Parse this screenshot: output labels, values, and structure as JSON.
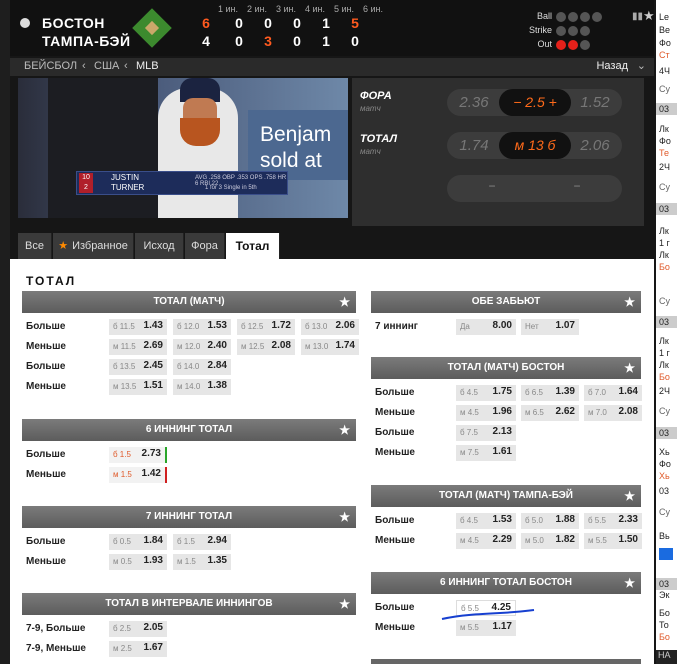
{
  "scoreboard": {
    "team_home": "БОСТОН",
    "team_away": "ТАМПА-БЭЙ",
    "innings": [
      "1 ин.",
      "2 ин.",
      "3 ин.",
      "4 ин.",
      "5 ин.",
      "6 ин."
    ],
    "home_scores": [
      "6",
      "0",
      "0",
      "0",
      "1",
      "5"
    ],
    "away_scores": [
      "4",
      "0",
      "3",
      "0",
      "1",
      "0"
    ],
    "ball_label": "Ball",
    "strike_label": "Strike",
    "out_label": "Out",
    "balls": 0,
    "strikes": 0,
    "outs": 2
  },
  "breadcrumb": {
    "items": [
      "БЕЙСБОЛ",
      "США",
      "MLB"
    ],
    "back_label": "Назад"
  },
  "video": {
    "sign_text": "Benjam sold at",
    "overlay_num1": "10",
    "overlay_num2": "2",
    "overlay_name1": "JUSTIN",
    "overlay_name2": "TURNER",
    "overlay_stats": "AVG .258  OBP .353  OPS .758  HR 6  RBI 22",
    "overlay_stats2": "1 for 3  Single in 5th"
  },
  "odds_panel": {
    "fora_label": "ФОРА",
    "fora_sub": "матч",
    "fora_left": "2.36",
    "fora_center": "− 2.5 +",
    "fora_right": "1.52",
    "total_label": "ТОТАЛ",
    "total_sub": "матч",
    "total_left": "1.74",
    "total_center": "м 13 б",
    "total_right": "2.06",
    "dash1": "−",
    "dash2": "−"
  },
  "tabs": [
    "Все",
    "Избранное",
    "Исход",
    "Фора",
    "Тотал"
  ],
  "content": {
    "title": "ТОТАЛ",
    "markets": {
      "total_match": {
        "title": "ТОТАЛ (МАТЧ)",
        "rows": [
          {
            "label": "Больше",
            "cells": [
              [
                "б 11.5",
                "1.43"
              ],
              [
                "б 12.0",
                "1.53"
              ],
              [
                "б 12.5",
                "1.72"
              ],
              [
                "б 13.0",
                "2.06"
              ]
            ]
          },
          {
            "label": "Меньше",
            "cells": [
              [
                "м 11.5",
                "2.69"
              ],
              [
                "м 12.0",
                "2.40"
              ],
              [
                "м 12.5",
                "2.08"
              ],
              [
                "м 13.0",
                "1.74"
              ]
            ]
          },
          {
            "label": "Больше",
            "cells": [
              [
                "б 13.5",
                "2.45"
              ],
              [
                "б 14.0",
                "2.84"
              ]
            ]
          },
          {
            "label": "Меньше",
            "cells": [
              [
                "м 13.5",
                "1.51"
              ],
              [
                "м 14.0",
                "1.38"
              ]
            ]
          }
        ]
      },
      "inning6_total": {
        "title": "6 ИННИНГ ТОТАЛ",
        "rows": [
          {
            "label": "Больше",
            "cells": [
              [
                "б 1.5",
                "2.73"
              ]
            ]
          },
          {
            "label": "Меньше",
            "cells": [
              [
                "м 1.5",
                "1.42"
              ]
            ]
          }
        ]
      },
      "inning7_total": {
        "title": "7 ИННИНГ ТОТАЛ",
        "rows": [
          {
            "label": "Больше",
            "cells": [
              [
                "б 0.5",
                "1.84"
              ],
              [
                "б 1.5",
                "2.94"
              ]
            ]
          },
          {
            "label": "Меньше",
            "cells": [
              [
                "м 0.5",
                "1.93"
              ],
              [
                "м 1.5",
                "1.35"
              ]
            ]
          }
        ]
      },
      "interval_total": {
        "title": "ТОТАЛ В ИНТЕРВАЛЕ ИННИНГОВ",
        "rows": [
          {
            "label": "7-9, Больше",
            "cells": [
              [
                "б 2.5",
                "2.05"
              ]
            ]
          },
          {
            "label": "7-9, Меньше",
            "cells": [
              [
                "м 2.5",
                "1.67"
              ]
            ]
          }
        ]
      },
      "both_score": {
        "title": "ОБЕ ЗАБЬЮТ",
        "rows": [
          {
            "label": "7 иннинг",
            "cells": [
              [
                "Да",
                "8.00"
              ],
              [
                "Нет",
                "1.07"
              ]
            ]
          }
        ]
      },
      "total_boston": {
        "title": "ТОТАЛ (МАТЧ) БОСТОН",
        "rows": [
          {
            "label": "Больше",
            "cells": [
              [
                "б 4.5",
                "1.75"
              ],
              [
                "б 6.5",
                "1.39"
              ],
              [
                "б 7.0",
                "1.64"
              ]
            ]
          },
          {
            "label": "Меньше",
            "cells": [
              [
                "м 4.5",
                "1.96"
              ],
              [
                "м 6.5",
                "2.62"
              ],
              [
                "м 7.0",
                "2.08"
              ]
            ]
          },
          {
            "label": "Больше",
            "cells": [
              [
                "б 7.5",
                "2.13"
              ]
            ]
          },
          {
            "label": "Меньше",
            "cells": [
              [
                "м 7.5",
                "1.61"
              ]
            ]
          }
        ]
      },
      "total_tampa": {
        "title": "ТОТАЛ (МАТЧ) ТАМПА-БЭЙ",
        "rows": [
          {
            "label": "Больше",
            "cells": [
              [
                "б 4.5",
                "1.53"
              ],
              [
                "б 5.0",
                "1.88"
              ],
              [
                "б 5.5",
                "2.33"
              ]
            ]
          },
          {
            "label": "Меньше",
            "cells": [
              [
                "м 4.5",
                "2.29"
              ],
              [
                "м 5.0",
                "1.82"
              ],
              [
                "м 5.5",
                "1.50"
              ]
            ]
          }
        ]
      },
      "inning6_boston": {
        "title": "6 ИННИНГ ТОТАЛ БОСТОН",
        "rows": [
          {
            "label": "Больше",
            "cells": [
              [
                "б 5.5",
                "4.25"
              ]
            ]
          },
          {
            "label": "Меньше",
            "cells": [
              [
                "м 5.5",
                "1.17"
              ]
            ]
          }
        ]
      }
    }
  },
  "right_strip": {
    "lines": [
      "Le",
      "Ве",
      "Фо",
      "Ст",
      "4Ч",
      "Су",
      "03",
      "Лк",
      "Фо",
      "Те",
      "2Ч",
      "Су",
      "03",
      "Лк",
      "1 г",
      "Лк",
      "Бо",
      "Су",
      "03",
      "Лк",
      "1 г",
      "Лк",
      "Бо",
      "2Ч",
      "Су",
      "03",
      "Хь",
      "Фо",
      "Хь",
      "03",
      "Су",
      "Вь",
      "03",
      "Эк",
      "Бо",
      "То",
      "Бо",
      "НА"
    ]
  },
  "colors": {
    "accent": "#ff6a1a",
    "header_gray": "#6b6b6b",
    "out_red": "#e5201a"
  }
}
